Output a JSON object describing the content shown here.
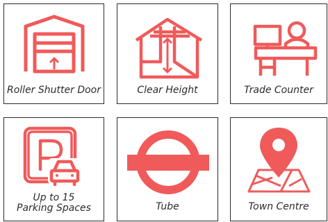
{
  "accent_color": "#f05a5a",
  "cards": [
    {
      "icon": "garage-shutter-icon",
      "label": "Roller Shutter Door"
    },
    {
      "icon": "house-height-icon",
      "label": "Clear Height"
    },
    {
      "icon": "counter-person-icon",
      "label": "Trade Counter"
    },
    {
      "icon": "parking-car-icon",
      "label_lines": [
        "Up to 15",
        "Parking Spaces"
      ]
    },
    {
      "icon": "tube-roundel-icon",
      "label": "Tube"
    },
    {
      "icon": "map-pin-icon",
      "label": "Town Centre"
    }
  ]
}
